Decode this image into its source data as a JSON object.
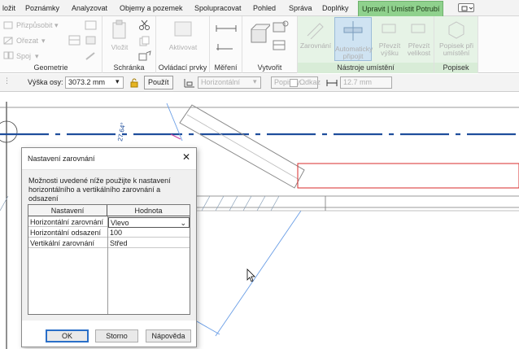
{
  "tabs": [
    {
      "label": "ložit"
    },
    {
      "label": "Poznámky"
    },
    {
      "label": "Analyzovat"
    },
    {
      "label": "Objemy a pozemek"
    },
    {
      "label": "Spolupracovat"
    },
    {
      "label": "Pohled"
    },
    {
      "label": "Správa"
    },
    {
      "label": "Doplňky"
    },
    {
      "label": "Upravit | Umístit Potrubí"
    }
  ],
  "ribbon": {
    "geometrie": {
      "title": "Geometrie",
      "prizpusobit": "Přizpůsobit",
      "orezat": "Ořezat",
      "spoj": "Spoj"
    },
    "schranka": {
      "title": "Schránka",
      "vlozit": "Vložit"
    },
    "ovladaci": {
      "title": "Ovládací prvky",
      "aktivovat": "Aktivovat"
    },
    "mereni": {
      "title": "Měření"
    },
    "vytvorit": {
      "title": "Vytvořit"
    },
    "nastroje": {
      "title": "Nástroje umístění",
      "zarovnani": "Zarovnání",
      "auto_line1": "Automaticky",
      "auto_line2": "připojit",
      "prevzit_vysku_line1": "Převzít",
      "prevzit_vysku_line2": "výšku",
      "prevzit_velikost_line1": "Převzít",
      "prevzit_velikost_line2": "velikost"
    },
    "popisek": {
      "title": "Popisek",
      "btn_line1": "Popisek při",
      "btn_line2": "umístění"
    }
  },
  "options_bar": {
    "vyska_label": "Výška osy:",
    "vyska_value": "3073.2 mm",
    "pouzit": "Použít",
    "horizontal": "Horizontální",
    "popisky": "Popisky...",
    "odkaz": "Odkaz",
    "size": "12.7 mm"
  },
  "canvas": {
    "angle_label": "27.64°"
  },
  "dialog": {
    "title": "Nastavení zarovnání",
    "close": "✕",
    "description": "Možnosti uvedené níže použijte k nastavení horizontálního a vertikálního zarovnání a odsazení",
    "columns": [
      "Nastavení",
      "Hodnota"
    ],
    "rows": [
      {
        "name": "Horizontální zarovnání",
        "value": "Vlevo"
      },
      {
        "name": "Horizontální odsazení",
        "value": "100"
      },
      {
        "name": "Vertikální zarovnání",
        "value": "Střed"
      }
    ],
    "buttons": {
      "ok": "OK",
      "storno": "Storno",
      "napoveda": "Nápověda"
    }
  },
  "colors": {
    "context_tab": "#8fd18d",
    "pipe_axis": "#1f4e9c",
    "selection_red": "#d92b2b",
    "guide_blue": "#6a9ee6"
  }
}
